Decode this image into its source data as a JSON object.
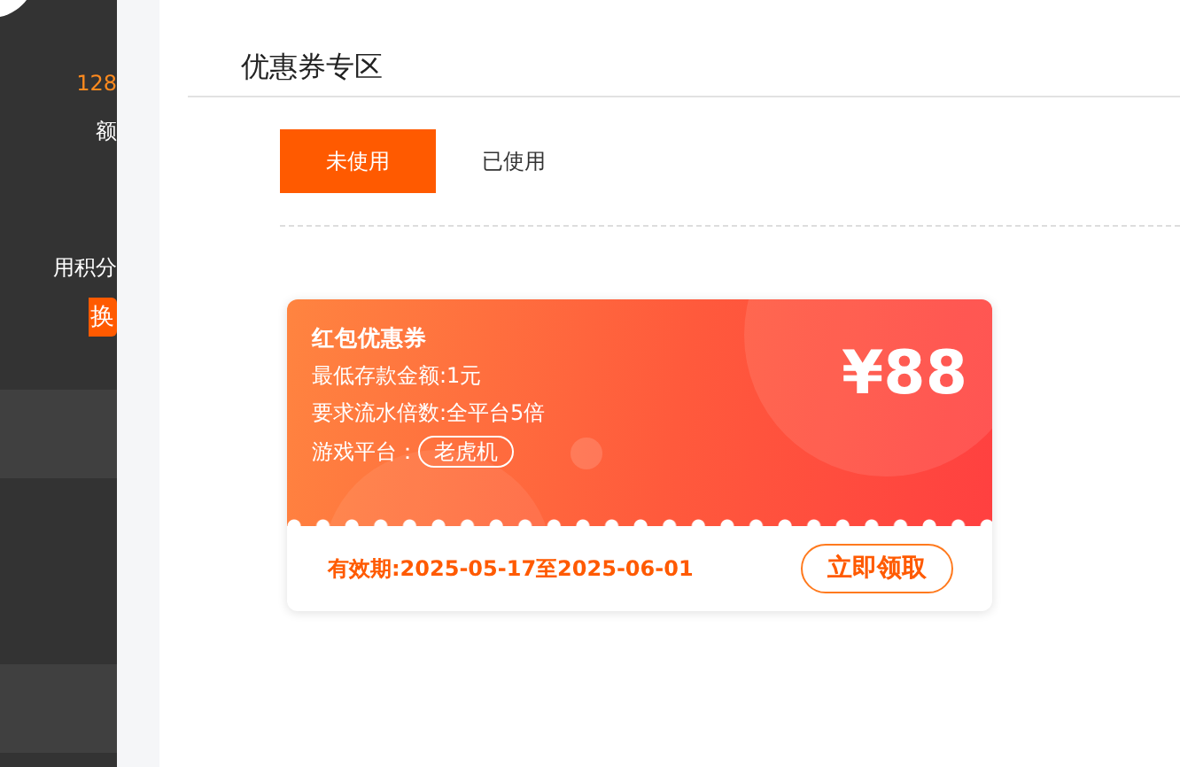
{
  "sidebar": {
    "balance": "128",
    "balance_label": "额",
    "points_label": "用积分",
    "exchange_button": "换",
    "items": [
      {
        "selected": true
      },
      {
        "selected": true
      }
    ]
  },
  "page": {
    "title": "优惠券专区"
  },
  "tabs": [
    {
      "label": "未使用",
      "selected": true
    },
    {
      "label": "已使用",
      "selected": false
    }
  ],
  "coupons": [
    {
      "title": "红包优惠券",
      "min_deposit": "最低存款金额:1元",
      "wager": "要求流水倍数:全平台5倍",
      "platform_label": "游戏平台：",
      "platform": "老虎机",
      "amount": "¥88",
      "validity": "有效期:2025-05-17至2025-06-01",
      "claim_button": "立即领取"
    }
  ]
}
